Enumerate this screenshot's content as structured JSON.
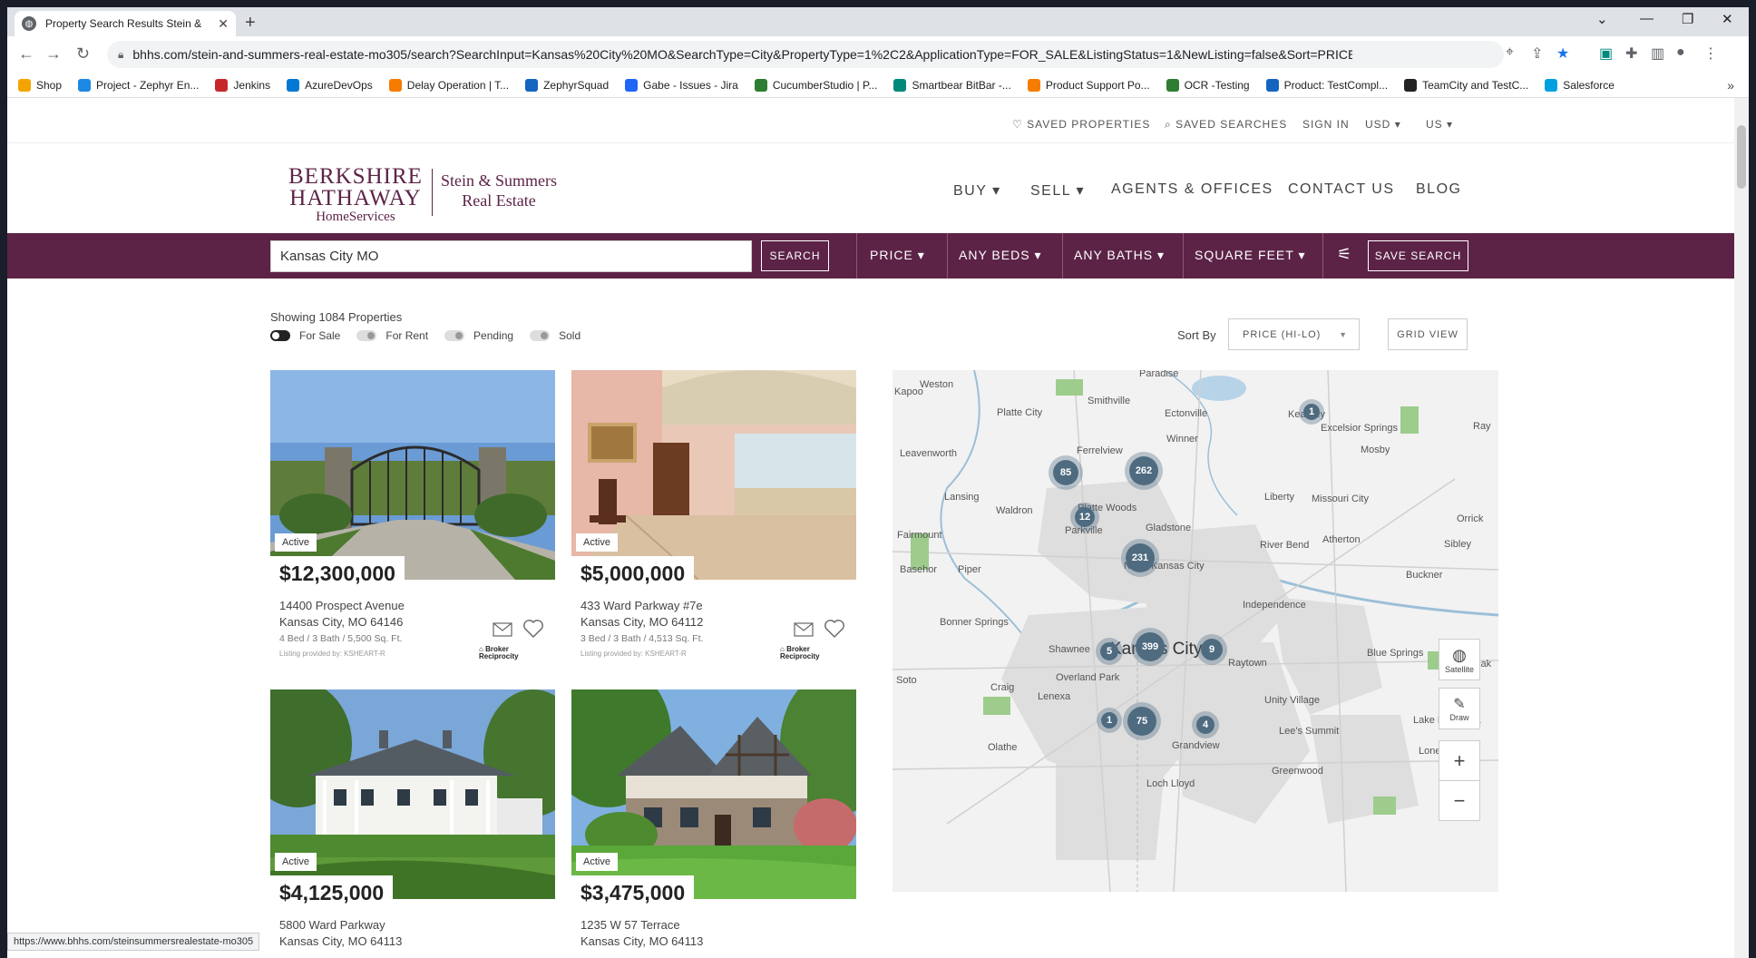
{
  "browser": {
    "tab_title": "Property Search Results Stein &",
    "url": "bhhs.com/stein-and-summers-real-estate-mo305/search?SearchInput=Kansas%20City%20MO&SearchType=City&PropertyType=1%2C2&ApplicationType=FOR_SALE&ListingStatus=1&NewListing=false&Sort=PRICE_DESCENDING&PageSize=...",
    "status_url": "https://www.bhhs.com/steinsummersrealestate-mo305"
  },
  "bookmarks": [
    {
      "label": "Shop",
      "color": "#f4a400"
    },
    {
      "label": "Project - Zephyr En...",
      "color": "#1e88e5"
    },
    {
      "label": "Jenkins",
      "color": "#c62828"
    },
    {
      "label": "AzureDevOps",
      "color": "#0078d4"
    },
    {
      "label": "Delay Operation | T...",
      "color": "#f57c00"
    },
    {
      "label": "ZephyrSquad",
      "color": "#1565c0"
    },
    {
      "label": "Gabe - Issues - Jira",
      "color": "#1e66f5"
    },
    {
      "label": "CucumberStudio | P...",
      "color": "#2e7d32"
    },
    {
      "label": "Smartbear BitBar -...",
      "color": "#00897b"
    },
    {
      "label": "Product Support Po...",
      "color": "#f57c00"
    },
    {
      "label": "OCR -Testing",
      "color": "#2e7d32"
    },
    {
      "label": "Product: TestCompl...",
      "color": "#1565c0"
    },
    {
      "label": "TeamCity and TestC...",
      "color": "#222222"
    },
    {
      "label": "Salesforce",
      "color": "#00a1e0"
    }
  ],
  "utility": {
    "saved_properties": "SAVED PROPERTIES",
    "saved_searches": "SAVED SEARCHES",
    "sign_in": "SIGN IN",
    "currency": "USD",
    "country": "US"
  },
  "brand": {
    "line1": "BERKSHIRE",
    "line2": "HATHAWAY",
    "line3": "HomeServices",
    "office1": "Stein & Summers",
    "office2": "Real Estate",
    "color": "#5c2347"
  },
  "nav": {
    "buy": "BUY",
    "sell": "SELL",
    "agents": "AGENTS & OFFICES",
    "contact": "CONTACT US",
    "blog": "BLOG"
  },
  "search": {
    "value": "Kansas City MO",
    "button": "SEARCH",
    "price": "PRICE",
    "beds": "ANY BEDS",
    "baths": "ANY BATHS",
    "sqft": "SQUARE FEET",
    "save": "SAVE SEARCH"
  },
  "results": {
    "showing": "Showing 1084 Properties",
    "for_sale": "For Sale",
    "for_rent": "For Rent",
    "pending": "Pending",
    "sold": "Sold",
    "sort_label": "Sort By",
    "sort_value": "PRICE (HI-LO)",
    "grid_view": "GRID VIEW"
  },
  "listings": [
    {
      "status": "Active",
      "price": "$12,300,000",
      "address": "14400 Prospect Avenue",
      "city": "Kansas City, MO 64146",
      "specs": "4 Bed / 3 Bath / 5,500 Sq. Ft.",
      "provider": "Listing provided by: KSHEART-R"
    },
    {
      "status": "Active",
      "price": "$5,000,000",
      "address": "433 Ward Parkway #7e",
      "city": "Kansas City, MO 64112",
      "specs": "3 Bed / 3 Bath / 4,513 Sq. Ft.",
      "provider": "Listing provided by: KSHEART-R"
    },
    {
      "status": "Active",
      "price": "$4,125,000",
      "address": "5800 Ward Parkway",
      "city": "Kansas City, MO 64113"
    },
    {
      "status": "Active",
      "price": "$3,475,000",
      "address": "1235 W 57 Terrace",
      "city": "Kansas City, MO 64113"
    }
  ],
  "broker_logo": {
    "line1": "Broker",
    "line2": "Reciprocity"
  },
  "map": {
    "city_label": "Kansas City",
    "satellite": "Satellite",
    "draw": "Draw",
    "places": [
      "Paradise",
      "Weston",
      "Smithville",
      "Platte City",
      "Ectonville",
      "Kearney",
      "Excelsior Springs",
      "Leavenworth",
      "Winner",
      "Mosby",
      "Ferrelview",
      "Lansing",
      "Liberty",
      "Missouri City",
      "Waldron",
      "Platte Woods",
      "Gladstone",
      "Parkville",
      "Fairmount",
      "River Bend",
      "Atherton",
      "Orrick",
      "Sibley",
      "Basehor",
      "Piper",
      "North Kansas City",
      "Buckner",
      "Independence",
      "Bonner Springs",
      "Shawnee",
      "Raytown",
      "Blue Springs",
      "Overland Park",
      "Soto",
      "Craig",
      "Lenexa",
      "Unity Village",
      "Lee's Summit",
      "Lake Lotawana",
      "Olathe",
      "Grandview",
      "Lone Jack",
      "Greenwood",
      "Loch Lloyd",
      "Kapoo",
      "Ray",
      "Oak"
    ],
    "clusters": [
      "1",
      "85",
      "262",
      "12",
      "231",
      "399",
      "5",
      "9",
      "75",
      "1",
      "4"
    ]
  }
}
